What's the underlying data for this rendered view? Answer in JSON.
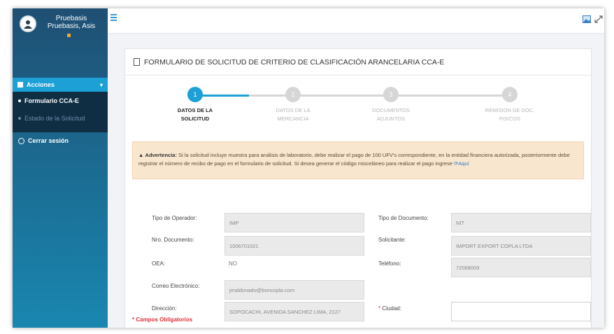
{
  "sidebar": {
    "user_name": "Pruebasis Pruebasis, Asis",
    "section_title": "Acciones",
    "items": [
      {
        "label": "Formulario CCA-E"
      },
      {
        "label": "Estado de la Solicitud"
      }
    ],
    "logout_label": "Cerrar sesión"
  },
  "form": {
    "title": "FORMULARIO DE SOLICITUD DE CRITERIO DE CLASIFICACIÓN ARANCELARIA CCA-E",
    "steps": [
      {
        "number": "1",
        "label_line1": "DATOS DE LA",
        "label_line2": "SOLICITUD"
      },
      {
        "number": "2",
        "label_line1": "DATOS DE LA",
        "label_line2": "MERCANCIA"
      },
      {
        "number": "3",
        "label_line1": "DOCUMENTOS",
        "label_line2": "ADJUNTOS"
      },
      {
        "number": "4",
        "label_line1": "REMISION DE DOC.",
        "label_line2": "FISICOS"
      }
    ],
    "alert": {
      "title": "Advertencia:",
      "text": "Si la solicitud incluye muestra para análisis de laboratorio, debe realizar el pago de 100 UFV's correspondiente, en la entidad financiera autorizada, posteriormente debe registrar el número de recibo de pago en el formulario de solicitud. Si desea generar el código misceláneo para realizar el pago ingrese",
      "link": "Aquí"
    },
    "fields": {
      "tipo_operador": {
        "label": "Tipo de Operador:",
        "value": "IMP"
      },
      "tipo_documento": {
        "label": "Tipo de Documento:",
        "value": "NIT"
      },
      "nro_documento": {
        "label": "Nro. Documento:",
        "value": "1006701021"
      },
      "solicitante": {
        "label": "Solicitante:",
        "value": "IMPORT EXPORT COPLA LTDA"
      },
      "oea": {
        "label": "OEA:",
        "value": "NO"
      },
      "telefono": {
        "label": "Teléfono:",
        "value": "72068009"
      },
      "correo": {
        "label": "Correo Electrónico:",
        "value": "jmaldonado@boncopla.com"
      },
      "direccion": {
        "label": "Dirección:",
        "value": "SOPOCACHI, AVENIDA SANCHEZ LIMA, 2127"
      },
      "ciudad": {
        "label": "Ciudad:",
        "required_mark": "*",
        "value": ""
      }
    },
    "mandatory_note": "* Campos Obligatorios"
  },
  "colors": {
    "accent": "#1ca0d6",
    "inactive_step": "#d6d6d6",
    "alert_bg": "#f9e6cf",
    "required": "#d9303b"
  }
}
